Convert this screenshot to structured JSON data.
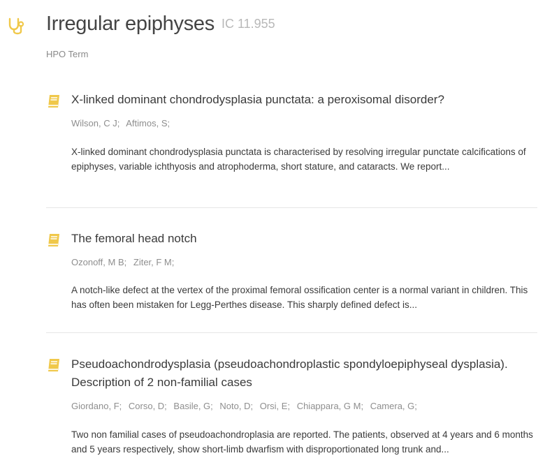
{
  "header": {
    "title": "Irregular epiphyses",
    "ic": "IC 11.955",
    "subtitle": "HPO Term",
    "icon": "stethoscope-icon"
  },
  "colors": {
    "accent": "#f0c84a",
    "title": "#444444",
    "muted": "#8e8e8e",
    "divider": "#e6e6e6"
  },
  "articles": [
    {
      "title": "X-linked dominant chondrodysplasia punctata: a peroxisomal disorder?",
      "authors": [
        "Wilson, C J;",
        "Aftimos, S;"
      ],
      "abstract": "X-linked dominant chondrodysplasia punctata is characterised by resolving irregular punctate calcifications of epiphyses, variable ichthyosis and atrophoderma, short stature, and cataracts. We report...",
      "icon": "book-icon"
    },
    {
      "title": "The femoral head notch",
      "authors": [
        "Ozonoff, M B;",
        "Ziter, F M;"
      ],
      "abstract": "A notch-like defect at the vertex of the proximal femoral ossification center is a normal variant in children. This has often been mistaken for Legg-Perthes disease. This sharply defined defect is...",
      "icon": "book-icon"
    },
    {
      "title": "Pseudoachondrodysplasia (pseudoachondroplastic spondyloepiphyseal dysplasia). Description of 2 non-familial cases",
      "authors": [
        "Giordano, F;",
        "Corso, D;",
        "Basile, G;",
        "Noto, D;",
        "Orsi, E;",
        "Chiappara, G M;",
        "Camera, G;"
      ],
      "abstract": "Two non familial cases of pseudoachondroplasia are reported. The patients, observed at 4 years and 6 months and 5 years respectively, show short-limb dwarfism with disproportionated long trunk and...",
      "icon": "book-icon"
    }
  ]
}
